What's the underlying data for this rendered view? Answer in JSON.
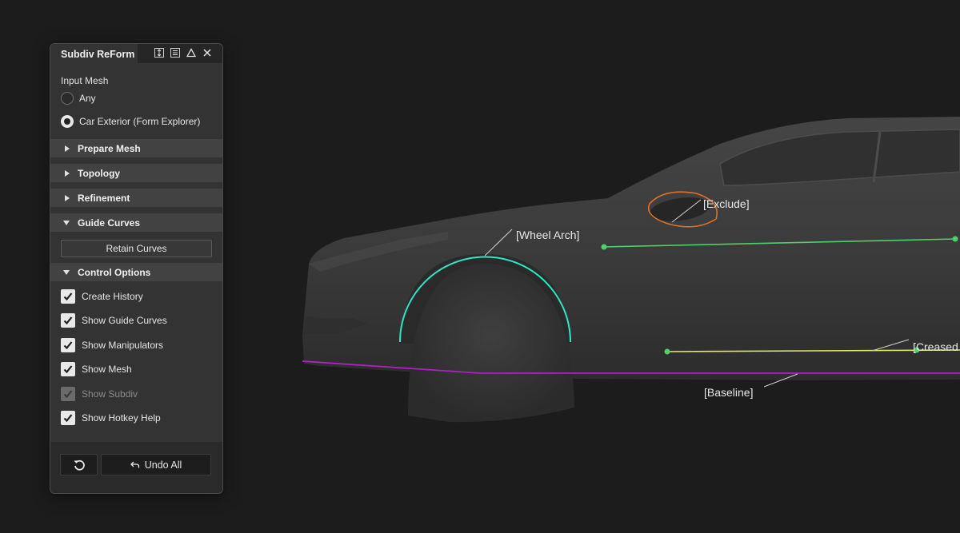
{
  "panel": {
    "tab_title": "Subdiv ReForm",
    "input_mesh": {
      "label": "Input Mesh",
      "options": [
        {
          "label": "Any",
          "selected": false
        },
        {
          "label": "Car Exterior (Form Explorer)",
          "selected": true
        }
      ]
    },
    "sections": {
      "prepare_mesh": {
        "label": "Prepare Mesh",
        "expanded": false
      },
      "topology": {
        "label": "Topology",
        "expanded": false
      },
      "refinement": {
        "label": "Refinement",
        "expanded": false
      },
      "guide_curves": {
        "label": "Guide Curves",
        "expanded": true
      },
      "control_options": {
        "label": "Control Options",
        "expanded": true
      }
    },
    "retain_curves_label": "Retain Curves",
    "control_options": [
      {
        "label": "Create History",
        "checked": true,
        "enabled": true
      },
      {
        "label": "Show Guide Curves",
        "checked": true,
        "enabled": true
      },
      {
        "label": "Show Manipulators",
        "checked": true,
        "enabled": true
      },
      {
        "label": "Show Mesh",
        "checked": true,
        "enabled": true
      },
      {
        "label": "Show Subdiv",
        "checked": true,
        "enabled": false
      },
      {
        "label": "Show Hotkey Help",
        "checked": true,
        "enabled": true
      }
    ],
    "footer": {
      "undo_all_label": "Undo All"
    },
    "titlebar_icons": [
      "resize-vertical-icon",
      "list-icon",
      "triangle-icon",
      "close-icon"
    ]
  },
  "viewport": {
    "annotations": {
      "exclude": "[Exclude]",
      "wheel_arch": "[Wheel Arch]",
      "creased": "[Creased",
      "baseline": "[Baseline]"
    },
    "colors": {
      "background": "#1c1c1c",
      "car_body": "#3a3a3a",
      "wheel_arch_curve": "#2ee6c4",
      "exclude_curve": "#e0702a",
      "guide_green": "#4fd06a",
      "creased_yellow": "#e6e66a",
      "baseline_magenta": "#b31ec8"
    }
  }
}
